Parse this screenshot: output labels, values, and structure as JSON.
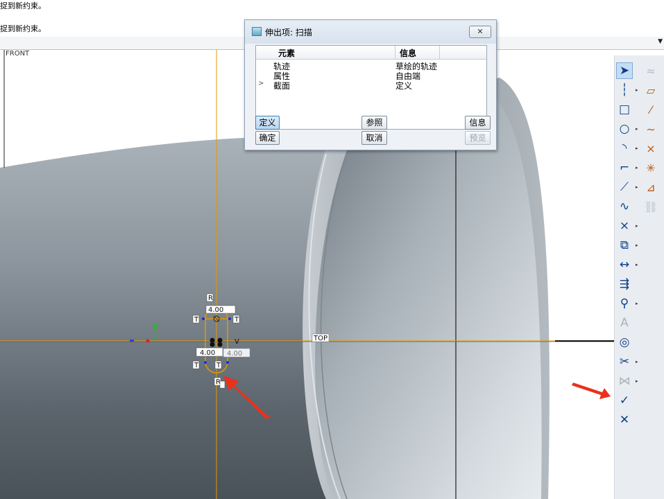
{
  "message_area": {
    "line1": "捉到新约束。",
    "line2": "捉到新约束。"
  },
  "graphics": {
    "datum_front_label": "FRONT",
    "datum_top_label": "TOP",
    "dimension_width": "4.00",
    "dimension_width_ghost": "4.00",
    "dimension_top": "4.00",
    "constraint_r_top": "R",
    "constraint_r_bottom": "R",
    "constraint_t_left": "T",
    "constraint_t_right": "T",
    "constraint_t_bottom_left": "T",
    "constraint_t_bottom_right": "T",
    "constraint_v": "V"
  },
  "dialog": {
    "title": "伸出项: 扫描",
    "columns": [
      "元素",
      "信息"
    ],
    "rows": [
      {
        "element": "轨迹",
        "info": "草绘的轨迹",
        "current": false
      },
      {
        "element": "属性",
        "info": "自由端",
        "current": false
      },
      {
        "element": "截面",
        "info": "定义",
        "current": true
      }
    ],
    "current_marker": ">",
    "buttons": {
      "define": "定义",
      "refs": "参照",
      "info": "信息",
      "ok": "确定",
      "cancel": "取消",
      "preview": "预览"
    },
    "close_glyph": "✕"
  },
  "toolbar": {
    "left_column": [
      {
        "icon": "select-arrow-icon",
        "glyph": "➤"
      },
      {
        "icon": "centerline-icon",
        "glyph": "┆"
      },
      {
        "icon": "rectangle-icon",
        "glyph": "□"
      },
      {
        "icon": "circle-icon",
        "glyph": "○"
      },
      {
        "icon": "arc-icon",
        "glyph": "◝"
      },
      {
        "icon": "fillet-icon",
        "glyph": "⌐"
      },
      {
        "icon": "chamfer-icon",
        "glyph": "⟋"
      },
      {
        "icon": "spline-icon",
        "glyph": "∿"
      },
      {
        "icon": "point-icon",
        "glyph": "×"
      },
      {
        "icon": "offset-entity-icon",
        "glyph": "⧉"
      },
      {
        "icon": "dimension-icon",
        "glyph": "↔"
      },
      {
        "icon": "modify-icon",
        "glyph": "⇶"
      },
      {
        "icon": "constraint-icon",
        "glyph": "⚲"
      },
      {
        "icon": "text-icon",
        "glyph": "A"
      },
      {
        "icon": "palette-icon",
        "glyph": "◎"
      },
      {
        "icon": "trim-icon",
        "glyph": "✂"
      },
      {
        "icon": "mirror-icon",
        "glyph": "⋈"
      },
      {
        "icon": "accept-check-icon",
        "glyph": "✓"
      },
      {
        "icon": "cancel-x-icon",
        "glyph": "✕"
      }
    ],
    "right_column": [
      {
        "icon": "datum-plane-icon",
        "glyph": "≈"
      },
      {
        "icon": "parallelogram-icon",
        "glyph": "▱"
      },
      {
        "icon": "datum-axis-icon",
        "glyph": "⁄"
      },
      {
        "icon": "curve-icon",
        "glyph": "∼"
      },
      {
        "icon": "datum-point-icon",
        "glyph": "×"
      },
      {
        "icon": "coordinate-system-icon",
        "glyph": "✳"
      },
      {
        "icon": "analysis-icon",
        "glyph": "⊿"
      },
      {
        "icon": "chain-link-icon",
        "glyph": "⛓"
      }
    ],
    "colors": {
      "icon_blue": "#0d3f8a",
      "icon_orange": "#c05a10",
      "disabled": "#aab3bb"
    }
  },
  "colors": {
    "sketch_line": "#e09a00",
    "model_gray_dark": "#5f6870",
    "model_gray_light": "#a5adb4",
    "annotation_arrow": "#e8321e"
  }
}
